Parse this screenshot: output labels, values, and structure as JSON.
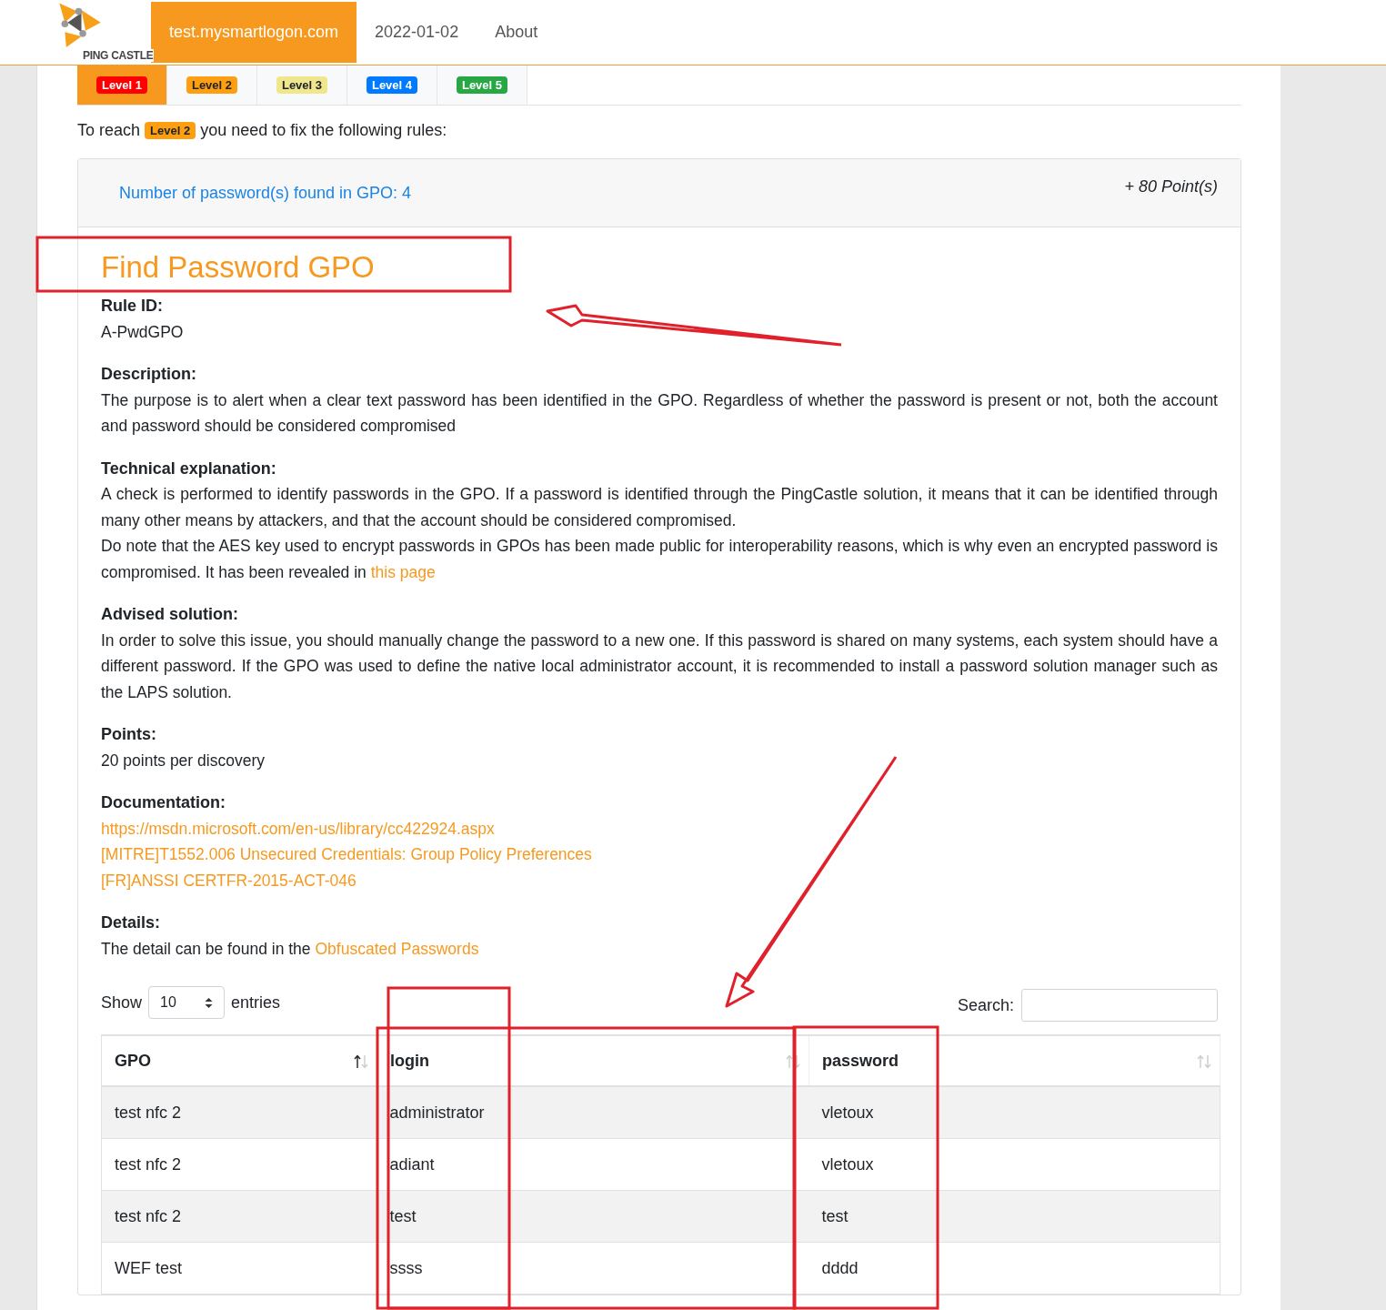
{
  "header": {
    "logo_text": "PING CASTLE",
    "nav": [
      {
        "label": "test.mysmartlogon.com",
        "selected": true
      },
      {
        "label": "2022-01-02",
        "selected": false
      },
      {
        "label": "About",
        "selected": false
      }
    ]
  },
  "level_tabs": [
    {
      "label": "Level 1",
      "color": "#ff0000",
      "selected": true
    },
    {
      "label": "Level 2",
      "color": "#fd9f10",
      "selected": false
    },
    {
      "label": "Level 3",
      "color": "#f0e68c",
      "selected": false
    },
    {
      "label": "Level 4",
      "color": "#007bff",
      "selected": false
    },
    {
      "label": "Level 5",
      "color": "#28a745",
      "selected": false
    }
  ],
  "intro": {
    "before": "To reach",
    "badge": {
      "label": "Level 2",
      "color": "#fd9f10"
    },
    "after": "you need to fix the following rules:"
  },
  "rule_card": {
    "title": "Number of password(s) found in GPO: 4",
    "points": "+ 80 Point(s)",
    "heading": "Find Password GPO",
    "sections": [
      {
        "label": "Rule ID:",
        "paragraphs": [
          {
            "text": "A-PwdGPO"
          }
        ]
      },
      {
        "label": "Description:",
        "paragraphs": [
          {
            "text": "The purpose is to alert when a clear text password has been identified in the GPO. Regardless of whether the password is present or not, both the account and password should be considered compromised"
          }
        ]
      },
      {
        "label": "Technical explanation:",
        "paragraphs": [
          {
            "text": "A check is performed to identify passwords in the GPO. If a password is identified through the PingCastle solution, it means that it can be identified through many other means by attackers, and that the account should be considered compromised."
          },
          {
            "text": "Do note that the AES key used to encrypt passwords in GPOs has been made public for interoperability reasons, which is why even an encrypted password is compromised. It has been revealed in",
            "link": "this page"
          }
        ]
      },
      {
        "label": "Advised solution:",
        "paragraphs": [
          {
            "text": "In order to solve this issue, you should manually change the password to a new one. If this password is shared on many systems, each system should have a different password. If the GPO was used to define the native local administrator account, it is recommended to install a password solution manager such as the LAPS solution."
          }
        ]
      },
      {
        "label": "Points:",
        "paragraphs": [
          {
            "text": "20 points per discovery"
          }
        ]
      },
      {
        "label": "Documentation:",
        "paragraphs": [
          {
            "link": "https://msdn.microsoft.com/en-us/library/cc422924.aspx"
          },
          {
            "link": "[MITRE]T1552.006 Unsecured Credentials: Group Policy Preferences"
          },
          {
            "link": "[FR]ANSSI CERTFR-2015-ACT-046"
          }
        ]
      },
      {
        "label": "Details:",
        "paragraphs": [
          {
            "text": "The detail can be found in the",
            "link": "Obfuscated Passwords"
          }
        ]
      }
    ]
  },
  "table": {
    "show_label": "Show",
    "page_size": "10",
    "entries_label": "entries",
    "search_label": "Search:",
    "columns": [
      {
        "label": "GPO",
        "sorted": true
      },
      {
        "label": "login",
        "sorted": false
      },
      {
        "label": "password",
        "sorted": false
      }
    ],
    "rows": [
      [
        "test nfc 2",
        "administrator",
        "vletoux"
      ],
      [
        "test nfc 2",
        "adiant",
        "vletoux"
      ],
      [
        "test nfc 2",
        "test",
        "test"
      ],
      [
        "WEF test",
        "ssss",
        "dddd"
      ]
    ]
  }
}
